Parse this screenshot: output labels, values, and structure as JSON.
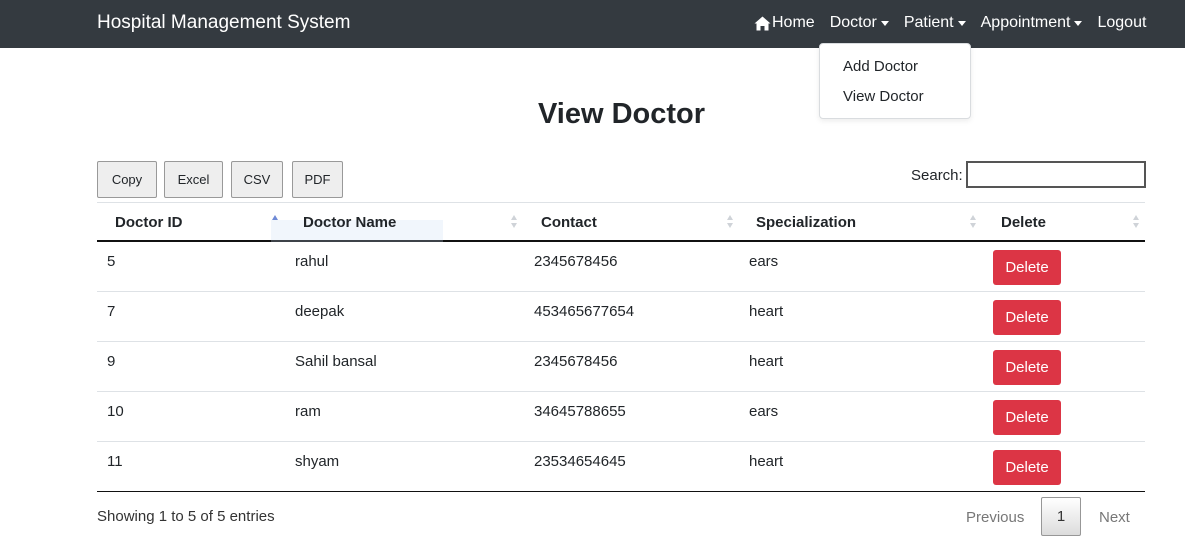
{
  "navbar": {
    "brand": "Hospital Management System",
    "items": [
      {
        "label": "Home",
        "icon": "home-icon"
      },
      {
        "label": "Doctor",
        "icon": "caret-down-icon"
      },
      {
        "label": "Patient",
        "icon": "caret-down-icon"
      },
      {
        "label": "Appointment",
        "icon": "caret-down-icon"
      },
      {
        "label": "Logout"
      }
    ],
    "dropdown": [
      "Add Doctor",
      "View Doctor"
    ]
  },
  "page": {
    "title": "View Doctor"
  },
  "toolbar": {
    "buttons": [
      "Copy",
      "Excel",
      "CSV",
      "PDF"
    ],
    "search_label": "Search:",
    "search_value": ""
  },
  "table": {
    "headers": [
      "Doctor ID",
      "Doctor Name",
      "Contact",
      "Specialization",
      "Delete"
    ],
    "sorted_column": "Doctor ID",
    "rows": [
      {
        "id": "5",
        "name": "rahul",
        "contact": "2345678456",
        "specialization": "ears",
        "action": "Delete"
      },
      {
        "id": "7",
        "name": "deepak",
        "contact": "453465677654",
        "specialization": "heart",
        "action": "Delete"
      },
      {
        "id": "9",
        "name": "Sahil bansal",
        "contact": "2345678456",
        "specialization": "heart",
        "action": "Delete"
      },
      {
        "id": "10",
        "name": "ram",
        "contact": "34645788655",
        "specialization": "ears",
        "action": "Delete"
      },
      {
        "id": "11",
        "name": "shyam",
        "contact": "23534654645",
        "specialization": "heart",
        "action": "Delete"
      }
    ]
  },
  "footer": {
    "info": "Showing 1 to 5 of 5 entries",
    "previous": "Previous",
    "current_page": "1",
    "next": "Next"
  },
  "colors": {
    "navbar": "#343a40",
    "danger": "#dc3545",
    "sort_active": "#6f8ad6"
  }
}
